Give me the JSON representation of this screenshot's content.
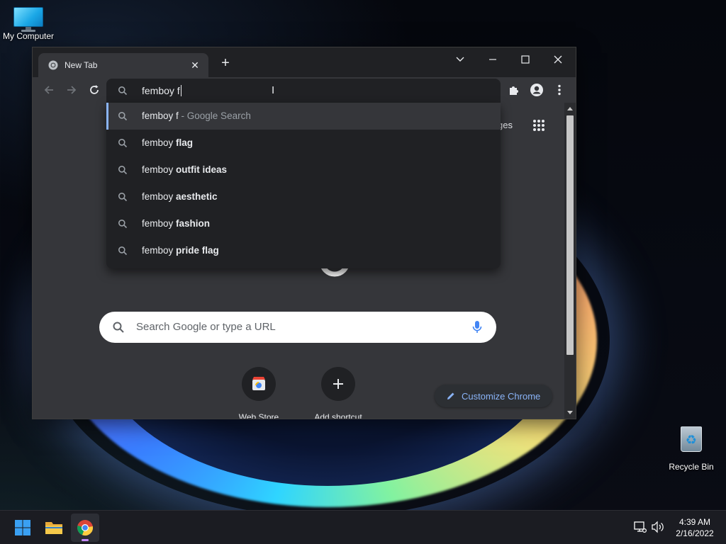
{
  "desktop": {
    "icons": [
      {
        "label": "My Computer"
      },
      {
        "label": "Recycle Bin"
      }
    ]
  },
  "browser": {
    "tab": {
      "title": "New Tab"
    },
    "omnibox": {
      "value": "femboy f"
    },
    "suggestions": [
      {
        "typed": "femboy f",
        "completion": "",
        "suffix": " - Google Search"
      },
      {
        "typed": "femboy ",
        "completion": "flag",
        "suffix": ""
      },
      {
        "typed": "femboy ",
        "completion": "outfit ideas",
        "suffix": ""
      },
      {
        "typed": "femboy ",
        "completion": "aesthetic",
        "suffix": ""
      },
      {
        "typed": "femboy ",
        "completion": "fashion",
        "suffix": ""
      },
      {
        "typed": "femboy ",
        "completion": "pride flag",
        "suffix": ""
      }
    ],
    "ntp": {
      "images_link": "ges",
      "search_placeholder": "Search Google or type a URL",
      "shortcuts": [
        {
          "label": "Web Store"
        },
        {
          "label": "Add shortcut"
        }
      ],
      "customize_label": "Customize Chrome"
    },
    "colors": {
      "accent": "#8ab4f8",
      "frame": "#202124",
      "toolbar": "#35363a"
    }
  },
  "taskbar": {
    "time": "4:39 AM",
    "date": "2/16/2022",
    "apps": [
      "windows-start",
      "file-explorer",
      "chrome"
    ]
  }
}
